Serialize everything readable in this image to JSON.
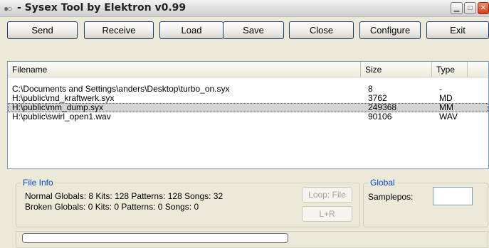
{
  "window": {
    "title": "- Sysex Tool by Elektron v0.99",
    "controls": [
      "minimize",
      "maximize",
      "close"
    ]
  },
  "toolbar": {
    "send": "Send",
    "receive": "Receive",
    "load": "Load",
    "save": "Save",
    "close": "Close",
    "configure": "Configure",
    "exit": "Exit"
  },
  "filelist": {
    "headers": {
      "filename": "Filename",
      "size": "Size",
      "type": "Type"
    },
    "rows": [
      {
        "filename": "C:\\Documents and Settings\\anders\\Desktop\\turbo_on.syx",
        "size": "8",
        "type": "-"
      },
      {
        "filename": "H:\\public\\md_kraftwerk.syx",
        "size": "3762",
        "type": "MD"
      },
      {
        "filename": "H:\\public\\mm_dump.syx",
        "size": "249368",
        "type": "MM",
        "selected": true
      },
      {
        "filename": "H:\\public\\swirl_open1.wav",
        "size": "90106",
        "type": "WAV"
      }
    ]
  },
  "fileinfo": {
    "legend": "File Info",
    "normal": "Normal Globals: 8 Kits: 128 Patterns: 128 Songs: 32",
    "broken": "Broken Globals: 0 Kits: 0 Patterns: 0 Songs: 0",
    "loop_file": "Loop: File",
    "lr": "L+R"
  },
  "global": {
    "legend": "Global",
    "samplepos_label": "Samplepos:",
    "samplepos_value": ""
  },
  "status": {
    "progress": 0.0
  }
}
